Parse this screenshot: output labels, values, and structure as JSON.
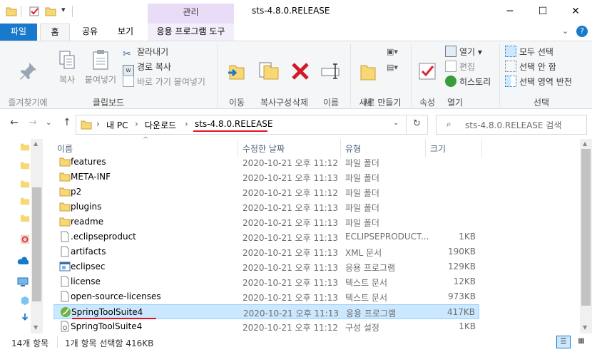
{
  "window": {
    "title": "sts-4.8.0.RELEASE",
    "context_tab": "관리",
    "minimize": "─",
    "maximize": "☐",
    "close": "✕"
  },
  "tabs": {
    "file": "파일",
    "home": "홈",
    "share": "공유",
    "view": "보기",
    "app_tools": "응용 프로그램 도구"
  },
  "ribbon": {
    "clipboard": {
      "pin": "즐겨찾기에\n고정",
      "copy": "복사",
      "paste": "붙여넣기",
      "cut": "잘라내기",
      "copy_path": "경로 복사",
      "paste_shortcut": "바로 가기 붙여넣기",
      "label": "클립보드"
    },
    "organize": {
      "move_to": "이동\n위치 ▾",
      "copy_to": "복사\n위치 ▾",
      "delete": "삭제\n▾",
      "rename": "이름\n바꾸기",
      "label": "구성"
    },
    "new": {
      "new_folder": "새\n폴더",
      "label": "새로 만들기"
    },
    "open": {
      "properties": "속성\n▾",
      "open": "열기 ▾",
      "edit": "편집",
      "history": "히스토리",
      "label": "열기"
    },
    "select": {
      "select_all": "모두 선택",
      "select_none": "선택 안 함",
      "invert": "선택 영역 반전",
      "label": "선택"
    }
  },
  "address": {
    "crumbs": [
      "내 PC",
      "다운로드",
      "sts-4.8.0.RELEASE"
    ],
    "search_placeholder": "sts-4.8.0.RELEASE 검색"
  },
  "columns": {
    "name": "이름",
    "date": "수정한 날짜",
    "type": "유형",
    "size": "크기"
  },
  "files": [
    {
      "name": "features",
      "date": "2020-10-21 오후 11:12",
      "type": "파일 폴더",
      "size": "",
      "icon": "folder-icon"
    },
    {
      "name": "META-INF",
      "date": "2020-10-21 오후 11:13",
      "type": "파일 폴더",
      "size": "",
      "icon": "folder-icon"
    },
    {
      "name": "p2",
      "date": "2020-10-21 오후 11:12",
      "type": "파일 폴더",
      "size": "",
      "icon": "folder-icon"
    },
    {
      "name": "plugins",
      "date": "2020-10-21 오후 11:13",
      "type": "파일 폴더",
      "size": "",
      "icon": "folder-icon"
    },
    {
      "name": "readme",
      "date": "2020-10-21 오후 11:13",
      "type": "파일 폴더",
      "size": "",
      "icon": "folder-icon"
    },
    {
      "name": ".eclipseproduct",
      "date": "2020-10-21 오후 11:13",
      "type": "ECLIPSEPRODUCT...",
      "size": "1KB",
      "icon": "file-icon"
    },
    {
      "name": "artifacts",
      "date": "2020-10-21 오후 11:13",
      "type": "XML 문서",
      "size": "190KB",
      "icon": "file-icon"
    },
    {
      "name": "eclipsec",
      "date": "2020-10-21 오후 11:13",
      "type": "응용 프로그램",
      "size": "129KB",
      "icon": "app-icon"
    },
    {
      "name": "license",
      "date": "2020-10-21 오후 11:13",
      "type": "텍스트 문서",
      "size": "12KB",
      "icon": "file-icon"
    },
    {
      "name": "open-source-licenses",
      "date": "2020-10-21 오후 11:13",
      "type": "텍스트 문서",
      "size": "973KB",
      "icon": "file-icon"
    },
    {
      "name": "SpringToolSuite4",
      "date": "2020-10-21 오후 11:13",
      "type": "응용 프로그램",
      "size": "417KB",
      "icon": "spring-icon",
      "selected": true
    },
    {
      "name": "SpringToolSuite4",
      "date": "2020-10-21 오후 11:12",
      "type": "구성 설정",
      "size": "1KB",
      "icon": "settings-file-icon"
    }
  ],
  "status": {
    "count": "14개 항목",
    "selection": "1개 항목 선택함 416KB"
  },
  "colors": {
    "file_tab": "#1979ca",
    "selection": "#cce8ff",
    "underline": "#e81123",
    "folder": "#f8d775"
  }
}
